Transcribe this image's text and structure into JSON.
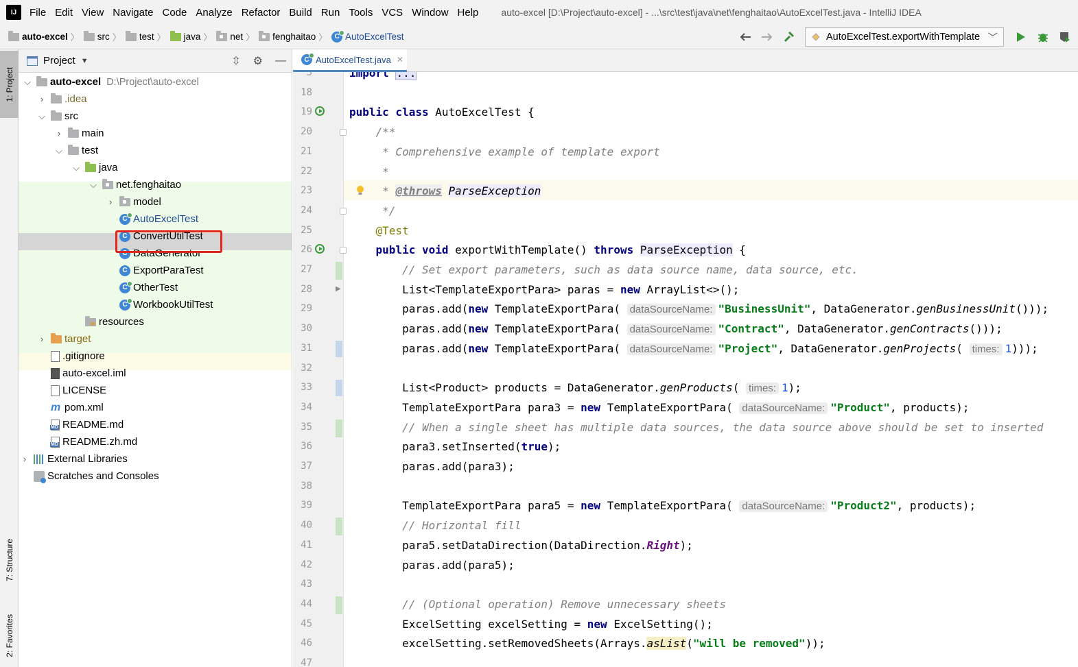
{
  "menubar": {
    "logo_text": "IJ",
    "items": [
      "File",
      "Edit",
      "View",
      "Navigate",
      "Code",
      "Analyze",
      "Refactor",
      "Build",
      "Run",
      "Tools",
      "VCS",
      "Window",
      "Help"
    ],
    "window_title": "auto-excel [D:\\Project\\auto-excel] - ...\\src\\test\\java\\net\\fenghaitao\\AutoExcelTest.java - IntelliJ IDEA"
  },
  "breadcrumbs": [
    "auto-excel",
    "src",
    "test",
    "java",
    "net",
    "fenghaitao",
    "AutoExcelTest"
  ],
  "toolbar": {
    "back_icon": "arrow-left-icon",
    "forward_icon": "arrow-right-icon",
    "build_icon": "hammer-icon",
    "run_config": "AutoExcelTest.exportWithTemplate",
    "run_icon": "run-icon",
    "debug_icon": "debug-icon",
    "coverage_icon": "coverage-icon"
  },
  "left_strip": {
    "project_tab": "1: Project",
    "structure_tab": "7: Structure",
    "favorites_tab": "2: Favorites"
  },
  "project_panel": {
    "title": "Project",
    "tree": [
      {
        "label": "auto-excel",
        "hint": "D:\\Project\\auto-excel",
        "depth": 0,
        "icon": "module-folder-icon",
        "expanded": true
      },
      {
        "label": ".idea",
        "depth": 1,
        "icon": "folder-icon",
        "expanded": false
      },
      {
        "label": "src",
        "depth": 1,
        "icon": "folder-icon",
        "expanded": true
      },
      {
        "label": "main",
        "depth": 2,
        "icon": "folder-icon",
        "expanded": false
      },
      {
        "label": "test",
        "depth": 2,
        "icon": "folder-icon",
        "expanded": true
      },
      {
        "label": "java",
        "depth": 3,
        "icon": "test-source-folder-icon",
        "expanded": true
      },
      {
        "label": "net.fenghaitao",
        "depth": 4,
        "icon": "package-icon",
        "expanded": true
      },
      {
        "label": "model",
        "depth": 5,
        "icon": "package-icon",
        "expanded": false
      },
      {
        "label": "AutoExcelTest",
        "depth": 5,
        "icon": "test-class-icon",
        "selected": true
      },
      {
        "label": "ConvertUtilTest",
        "depth": 5,
        "icon": "class-icon"
      },
      {
        "label": "DataGenerator",
        "depth": 5,
        "icon": "class-icon"
      },
      {
        "label": "ExportParaTest",
        "depth": 5,
        "icon": "class-icon"
      },
      {
        "label": "OtherTest",
        "depth": 5,
        "icon": "test-class-icon"
      },
      {
        "label": "WorkbookUtilTest",
        "depth": 5,
        "icon": "test-class-icon"
      },
      {
        "label": "resources",
        "depth": 4,
        "icon": "resources-folder-icon"
      },
      {
        "label": "target",
        "depth": 1,
        "icon": "excluded-folder-icon",
        "expanded": false
      },
      {
        "label": ".gitignore",
        "depth": 1,
        "icon": "gitignore-file-icon"
      },
      {
        "label": "auto-excel.iml",
        "depth": 1,
        "icon": "iml-file-icon"
      },
      {
        "label": "LICENSE",
        "depth": 1,
        "icon": "text-file-icon"
      },
      {
        "label": "pom.xml",
        "depth": 1,
        "icon": "maven-icon"
      },
      {
        "label": "README.md",
        "depth": 1,
        "icon": "markdown-file-icon"
      },
      {
        "label": "README.zh.md",
        "depth": 1,
        "icon": "markdown-file-icon"
      },
      {
        "label": "External Libraries",
        "depth": 0,
        "icon": "library-icon",
        "expanded": false
      },
      {
        "label": "Scratches and Consoles",
        "depth": 0,
        "icon": "scratches-icon"
      }
    ]
  },
  "editor": {
    "tab_label": "AutoExcelTest.java",
    "lines": [
      {
        "n": "3",
        "html": "<span class=\"kw\">import</span> <span style=\"background:#e4e4ff;border:1px solid #b0b0d0;\">...</span>"
      },
      {
        "n": "18",
        "html": ""
      },
      {
        "n": "19",
        "html": "<span class=\"kw\">public class</span> AutoExcelTest {"
      },
      {
        "n": "20",
        "html": "    <span class=\"cm\">/**</span>"
      },
      {
        "n": "21",
        "html": "<span class=\"cm\">     * Comprehensive example of template export</span>"
      },
      {
        "n": "22",
        "html": "<span class=\"cm\">     *</span>"
      },
      {
        "n": "23",
        "html": "<span class=\"cm\">     * </span><span class=\"tg\">@throws</span> <span class=\"it\" style=\"background:#edebfc;\">ParseException</span>"
      },
      {
        "n": "24",
        "html": "<span class=\"cm\">     */</span>"
      },
      {
        "n": "25",
        "html": "    <span class=\"an\">@Test</span>"
      },
      {
        "n": "26",
        "html": "    <span class=\"kw\">public void</span> exportWithTemplate() <span class=\"kw\">throws</span> <span class=\"hl\">ParseException</span> {"
      },
      {
        "n": "27",
        "html": "<span class=\"cm\">        // Set export parameters, such as data source name, data source, etc.</span>"
      },
      {
        "n": "28",
        "html": "        List&lt;TemplateExportPara&gt; paras = <span class=\"kw\">new</span> ArrayList&lt;&gt;();"
      },
      {
        "n": "29",
        "html": "        paras.add(<span class=\"kw\">new</span> TemplateExportPara( <span class=\"hint-chip\">dataSourceName:</span><span class=\"st\">\"BusinessUnit\"</span>, DataGenerator.<span class=\"it\">genBusinessUnit</span>()));"
      },
      {
        "n": "30",
        "html": "        paras.add(<span class=\"kw\">new</span> TemplateExportPara( <span class=\"hint-chip\">dataSourceName:</span><span class=\"st\">\"Contract\"</span>, DataGenerator.<span class=\"it\">genContracts</span>()));"
      },
      {
        "n": "31",
        "html": "        paras.add(<span class=\"kw\">new</span> TemplateExportPara( <span class=\"hint-chip\">dataSourceName:</span><span class=\"st\">\"Project\"</span>, DataGenerator.<span class=\"it\">genProjects</span>( <span class=\"hint-chip\">times:</span><span class=\"num\">1</span>)));"
      },
      {
        "n": "32",
        "html": ""
      },
      {
        "n": "33",
        "html": "        List&lt;Product&gt; products = DataGenerator.<span class=\"it\">genProducts</span>( <span class=\"hint-chip\">times:</span><span class=\"num\">1</span>);"
      },
      {
        "n": "34",
        "html": "        TemplateExportPara para3 = <span class=\"kw\">new</span> TemplateExportPara( <span class=\"hint-chip\">dataSourceName:</span><span class=\"st\">\"Product\"</span>, products);"
      },
      {
        "n": "35",
        "html": "<span class=\"cm\">        // When a single sheet has multiple data sources, the data source above should be set to inserted</span>"
      },
      {
        "n": "36",
        "html": "        para3.setInserted(<span class=\"kw\">true</span>);"
      },
      {
        "n": "37",
        "html": "        paras.add(para3);"
      },
      {
        "n": "38",
        "html": ""
      },
      {
        "n": "39",
        "html": "        TemplateExportPara para5 = <span class=\"kw\">new</span> TemplateExportPara( <span class=\"hint-chip\">dataSourceName:</span><span class=\"st\">\"Product2\"</span>, products);"
      },
      {
        "n": "40",
        "html": "<span class=\"cm\">        // Horizontal fill</span>"
      },
      {
        "n": "41",
        "html": "        para5.setDataDirection(DataDirection.<span class=\"field\">Right</span>);"
      },
      {
        "n": "42",
        "html": "        paras.add(para5);"
      },
      {
        "n": "43",
        "html": ""
      },
      {
        "n": "44",
        "html": "<span class=\"cm\">        // (Optional operation) Remove unnecessary sheets</span>"
      },
      {
        "n": "45",
        "html": "        ExcelSetting excelSetting = <span class=\"kw\">new</span> ExcelSetting();"
      },
      {
        "n": "46",
        "html": "        excelSetting.setRemovedSheets(Arrays.<span class=\"it hl2\">asList</span>(<span class=\"st\">\"will be removed\"</span>));"
      },
      {
        "n": "47",
        "html": ""
      }
    ]
  }
}
